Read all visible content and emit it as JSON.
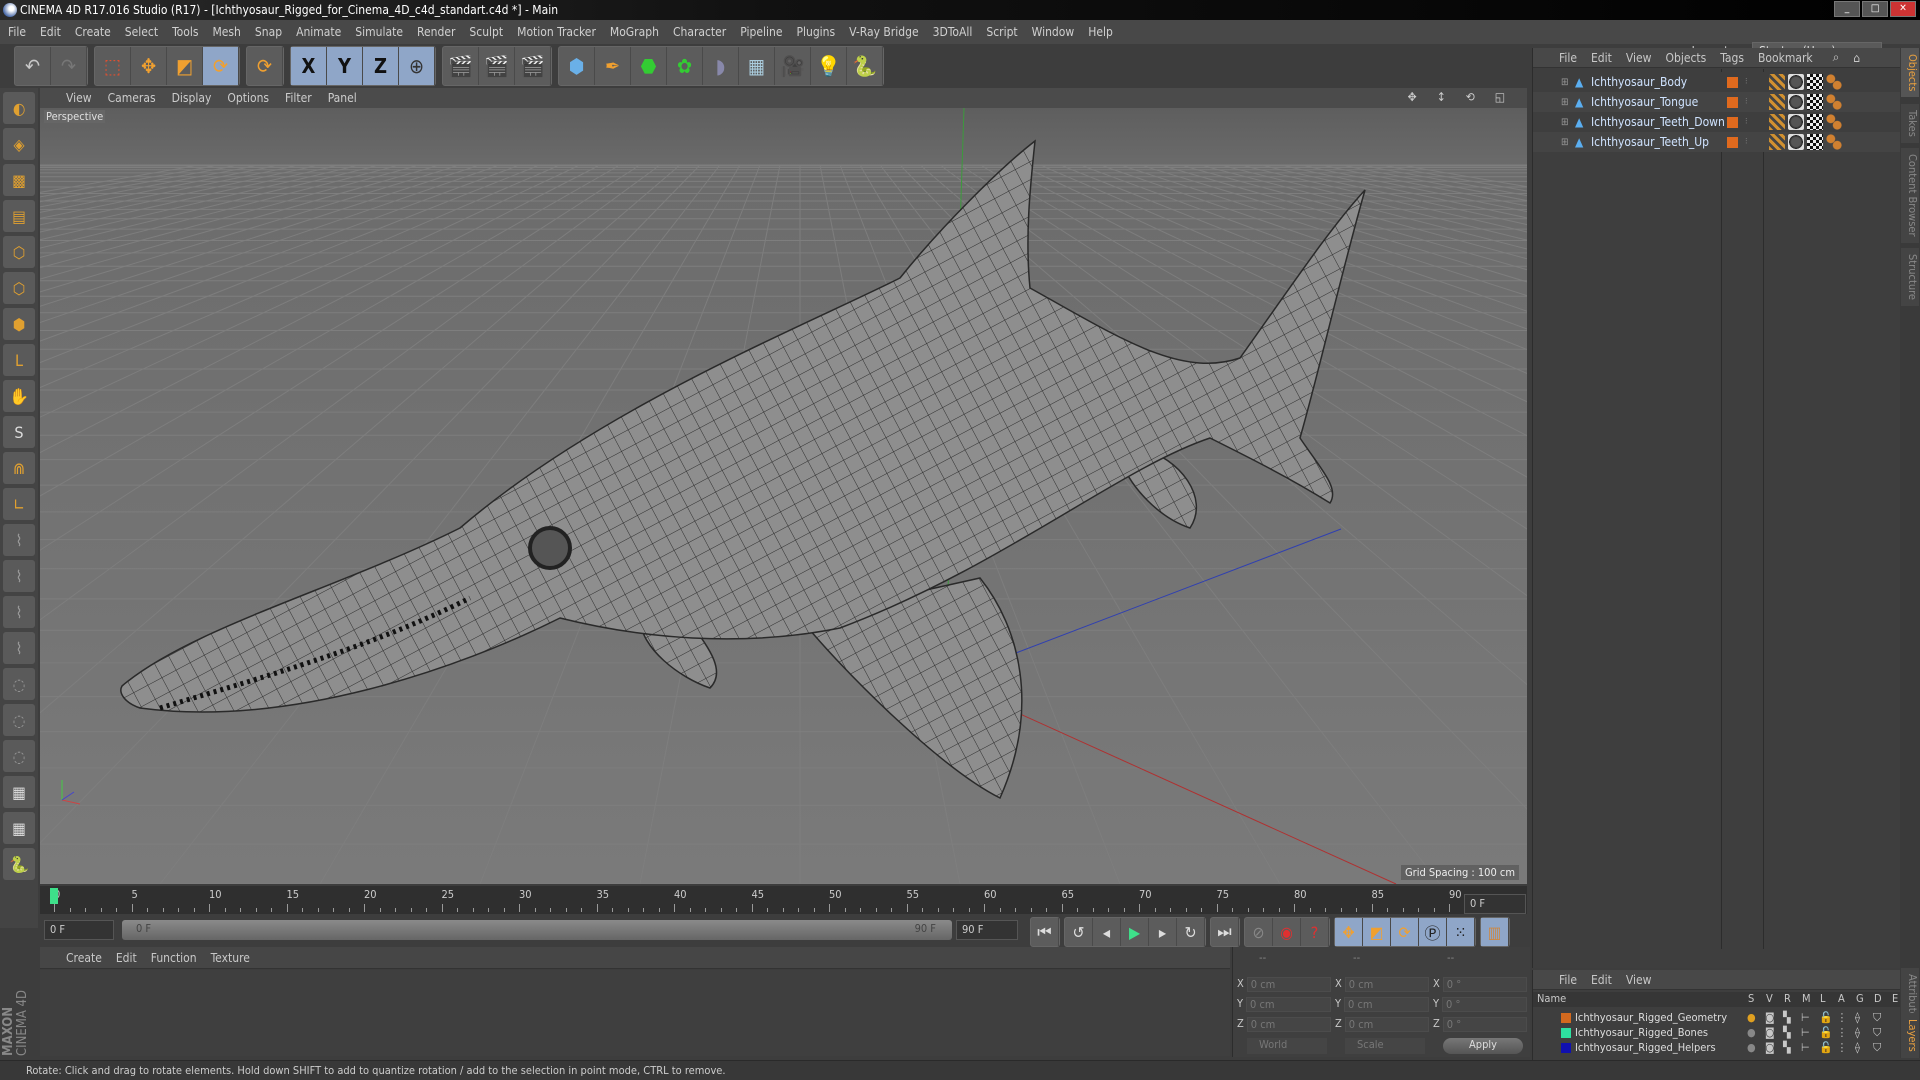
{
  "window": {
    "title": "CINEMA 4D R17.016 Studio (R17) - [Ichthyosaur_Rigged_for_Cinema_4D_c4d_standart.c4d *] - Main",
    "minimize": "_",
    "maximize": "□",
    "close": "✕"
  },
  "menu": [
    "File",
    "Edit",
    "Create",
    "Select",
    "Tools",
    "Mesh",
    "Snap",
    "Animate",
    "Simulate",
    "Render",
    "Sculpt",
    "Motion Tracker",
    "MoGraph",
    "Character",
    "Pipeline",
    "Plugins",
    "V-Ray Bridge",
    "3DToAll",
    "Script",
    "Window",
    "Help"
  ],
  "layout": {
    "label": "Layout:",
    "value": "Startup (User)"
  },
  "toolbar": {
    "x": "X",
    "y": "Y",
    "z": "Z"
  },
  "viewport": {
    "menu": [
      "View",
      "Cameras",
      "Display",
      "Options",
      "Filter",
      "Panel"
    ],
    "label": "Perspective",
    "grid_spacing": "Grid Spacing : 100 cm"
  },
  "timeline": {
    "ticks": [
      "0",
      "5",
      "10",
      "15",
      "20",
      "25",
      "30",
      "35",
      "40",
      "45",
      "50",
      "55",
      "60",
      "65",
      "70",
      "75",
      "80",
      "85",
      "90"
    ],
    "current": "0 F",
    "start": "0 F",
    "range_start": "0 F",
    "range_end": "90 F",
    "end": "90 F",
    "current_right": "0 F"
  },
  "material": {
    "menu": [
      "Create",
      "Edit",
      "Function",
      "Texture"
    ],
    "brand1": "MAXON",
    "brand2": "CINEMA 4D"
  },
  "coords": {
    "headers": [
      "--",
      "--",
      "--"
    ],
    "rows": [
      {
        "axis": "X",
        "pos": "0 cm",
        "size": "0 cm",
        "rot": "0 °"
      },
      {
        "axis": "Y",
        "pos": "0 cm",
        "size": "0 cm",
        "rot": "0 °"
      },
      {
        "axis": "Z",
        "pos": "0 cm",
        "size": "0 cm",
        "rot": "0 °"
      }
    ],
    "world": "World",
    "scale": "Scale",
    "apply": "Apply"
  },
  "objects": {
    "menu": [
      "File",
      "Edit",
      "View",
      "Objects",
      "Tags",
      "Bookmark"
    ],
    "items": [
      "Ichthyosaur_Body",
      "Ichthyosaur_Tongue",
      "Ichthyosaur_Teeth_Down",
      "Ichthyosaur_Teeth_Up"
    ],
    "color": "#e06a1e"
  },
  "layers": {
    "menu": [
      "File",
      "Edit",
      "View"
    ],
    "name_header": "Name",
    "cols": [
      "S",
      "V",
      "R",
      "M",
      "L",
      "A",
      "G",
      "D",
      "E"
    ],
    "items": [
      {
        "name": "Ichthyosaur_Rigged_Geometry",
        "color": "#d2691e"
      },
      {
        "name": "Ichthyosaur_Rigged_Bones",
        "color": "#2ee0a0"
      },
      {
        "name": "Ichthyosaur_Rigged_Helpers",
        "color": "#1010b0"
      }
    ]
  },
  "right_tabs": [
    "Objects",
    "Takes",
    "Content Browser",
    "Structure",
    "Attributes",
    "Layers"
  ],
  "status": "Rotate: Click and drag to rotate elements. Hold down SHIFT to add to quantize rotation / add to the selection in point mode, CTRL to remove."
}
